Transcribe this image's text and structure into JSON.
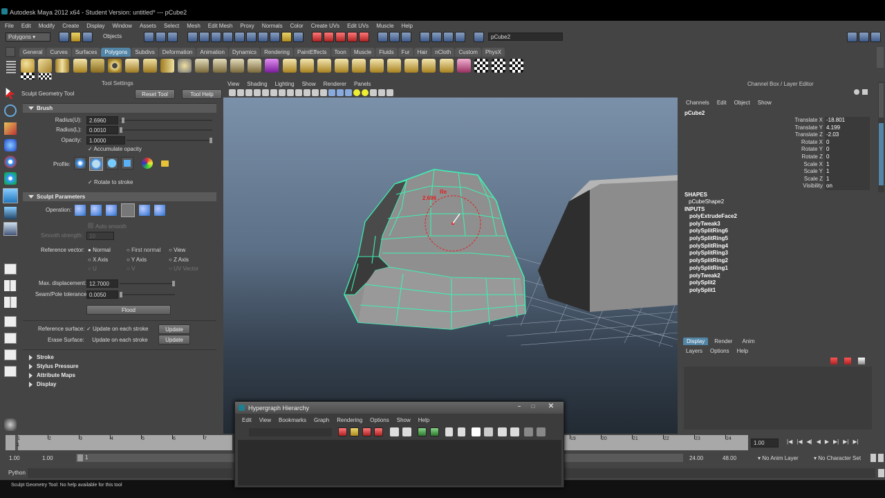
{
  "window": {
    "title": "Autodesk Maya 2012 x64 - Student Version: untitled*  ---  pCube2"
  },
  "menubar": [
    "File",
    "Edit",
    "Modify",
    "Create",
    "Display",
    "Window",
    "Assets",
    "Select",
    "Mesh",
    "Edit Mesh",
    "Proxy",
    "Normals",
    "Color",
    "Create UVs",
    "Edit UVs",
    "Muscle",
    "Help"
  ],
  "status": {
    "menu_set": "Polygons",
    "selection_mode": "Objects",
    "name_field": "pCube2"
  },
  "shelf_tabs": [
    "General",
    "Curves",
    "Surfaces",
    "Polygons",
    "Subdivs",
    "Deformation",
    "Animation",
    "Dynamics",
    "Rendering",
    "PaintEffects",
    "Toon",
    "Muscle",
    "Fluids",
    "Fur",
    "Hair",
    "nCloth",
    "Custom",
    "PhysX"
  ],
  "shelf_active": "Polygons",
  "tool_settings": {
    "header": "Tool Settings",
    "tool_name": "Sculpt Geometry Tool",
    "reset_label": "Reset Tool",
    "help_label": "Tool Help",
    "brush": {
      "title": "Brush",
      "radius_u_label": "Radius(U):",
      "radius_u": "2.6960",
      "radius_l_label": "Radius(L):",
      "radius_l": "0.0010",
      "opacity_label": "Opacity:",
      "opacity": "1.0000",
      "accumulate_label": "Accumulate opacity",
      "profile_label": "Profile:",
      "rotate_label": "Rotate to stroke"
    },
    "sculpt": {
      "title": "Sculpt Parameters",
      "operation_label": "Operation:",
      "auto_smooth_label": "Auto smooth",
      "smooth_strength_label": "Smooth strength:",
      "smooth_strength": "10",
      "ref_vector_label": "Reference vector:",
      "ref_options": [
        "Normal",
        "First normal",
        "View",
        "X Axis",
        "Y Axis",
        "Z Axis",
        "U",
        "V",
        "UV Vector"
      ],
      "max_disp_label": "Max. displacement:",
      "max_disp": "12.7000",
      "seam_label": "Seam/Pole tolerance:",
      "seam": "0.0050",
      "flood_label": "Flood",
      "ref_surface_label": "Reference surface:",
      "ref_surface_opt": "Update on each stroke",
      "erase_surface_label": "Erase Surface:",
      "erase_surface_opt": "Update on each stroke",
      "update_label": "Update"
    },
    "closed_sections": [
      "Stroke",
      "Stylus Pressure",
      "Attribute Maps",
      "Display"
    ]
  },
  "viewport": {
    "menus": [
      "View",
      "Shading",
      "Lighting",
      "Show",
      "Renderer",
      "Panels"
    ],
    "brush_value": "2.696",
    "brush_label": "Re"
  },
  "channel_box": {
    "header": "Channel Box / Layer Editor",
    "menus": [
      "Channels",
      "Edit",
      "Object",
      "Show"
    ],
    "object": "pCube2",
    "channels": [
      {
        "name": "Translate X",
        "value": "-18.801"
      },
      {
        "name": "Translate Y",
        "value": "4.199"
      },
      {
        "name": "Translate Z",
        "value": "-2.03"
      },
      {
        "name": "Rotate X",
        "value": "0"
      },
      {
        "name": "Rotate Y",
        "value": "0"
      },
      {
        "name": "Rotate Z",
        "value": "0"
      },
      {
        "name": "Scale X",
        "value": "1"
      },
      {
        "name": "Scale Y",
        "value": "1"
      },
      {
        "name": "Scale Z",
        "value": "1"
      },
      {
        "name": "Visibility",
        "value": "on"
      }
    ],
    "shapes_label": "SHAPES",
    "shape": "pCubeShape2",
    "inputs_label": "INPUTS",
    "inputs": [
      "polyExtrudeFace2",
      "polyTweak3",
      "polySplitRing6",
      "polySplitRing5",
      "polySplitRing4",
      "polySplitRing3",
      "polySplitRing2",
      "polySplitRing1",
      "polyTweak2",
      "polySplit2",
      "polySplit1"
    ]
  },
  "layer_editor": {
    "tabs": [
      "Display",
      "Render",
      "Anim"
    ],
    "active_tab": "Display",
    "menus": [
      "Layers",
      "Options",
      "Help"
    ]
  },
  "hypergraph": {
    "title": "Hypergraph Hierarchy",
    "menus": [
      "Edit",
      "View",
      "Bookmarks",
      "Graph",
      "Rendering",
      "Options",
      "Show",
      "Help"
    ]
  },
  "timeline": {
    "ticks": [
      "1",
      "2",
      "3",
      "4",
      "5",
      "6",
      "7",
      "8",
      "19",
      "20",
      "21",
      "22",
      "23",
      "24"
    ],
    "current_frame": "1.00",
    "range_start": "1.00",
    "range_start2": "1.00",
    "range_frame": "1",
    "range_end": "24.00",
    "range_end2": "48.00",
    "anim_layer": "No Anim Layer",
    "char_set": "No Character Set"
  },
  "command_line": {
    "label": "Python"
  },
  "help_line": "Sculpt Geometry Tool: No help available for this tool",
  "colors": {
    "accent": "#5285a6",
    "wire": "#3ef0b0",
    "brush": "#e02020"
  }
}
